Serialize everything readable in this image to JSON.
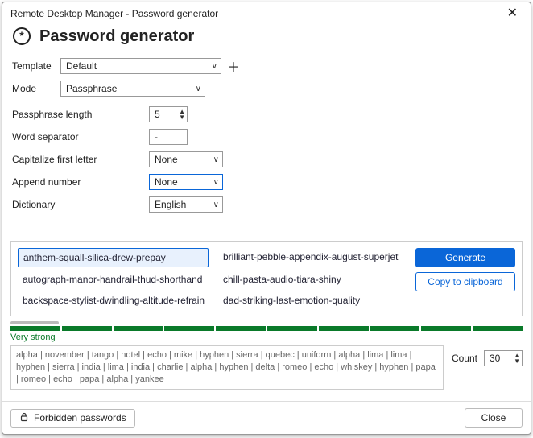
{
  "window": {
    "title": "Remote Desktop Manager - Password generator",
    "heading": "Password generator"
  },
  "form": {
    "template_label": "Template",
    "template_value": "Default",
    "mode_label": "Mode",
    "mode_value": "Passphrase",
    "length_label": "Passphrase length",
    "length_value": "5",
    "separator_label": "Word separator",
    "separator_value": "-",
    "capitalize_label": "Capitalize first letter",
    "capitalize_value": "None",
    "append_label": "Append number",
    "append_value": "None",
    "dictionary_label": "Dictionary",
    "dictionary_value": "English"
  },
  "results": {
    "col1": [
      "anthem-squall-silica-drew-prepay",
      "autograph-manor-handrail-thud-shorthand",
      "backspace-stylist-dwindling-altitude-refrain"
    ],
    "col2": [
      "brilliant-pebble-appendix-august-superjet",
      "chill-pasta-audio-tiara-shiny",
      "dad-striking-last-emotion-quality"
    ]
  },
  "actions": {
    "generate": "Generate",
    "copy": "Copy to clipboard"
  },
  "strength": {
    "label": "Very strong"
  },
  "phonetic": "alpha | november | tango | hotel | echo | mike | hyphen | sierra | quebec | uniform | alpha | lima | lima | hyphen | sierra | india | lima | india | charlie | alpha | hyphen | delta | romeo | echo | whiskey | hyphen | papa | romeo | echo | papa | alpha | yankee",
  "count": {
    "label": "Count",
    "value": "30"
  },
  "footer": {
    "forbidden": "Forbidden passwords",
    "close": "Close"
  }
}
